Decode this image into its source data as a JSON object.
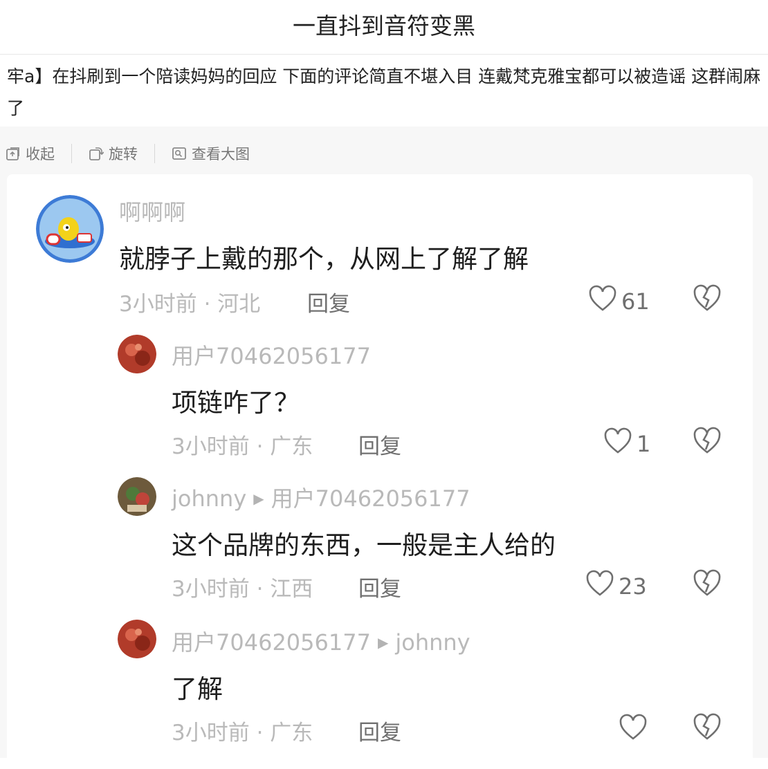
{
  "page": {
    "title": "一直抖到音符变黑",
    "post_text": "牢a】在抖刷到一个陪读妈妈的回应 下面的评论简直不堪入目 连戴梵克雅宝都可以被造谣 这群闹麻了"
  },
  "toolbar": {
    "collapse_label": "收起",
    "rotate_label": "旋转",
    "view_large_label": "查看大图"
  },
  "comments": [
    {
      "user": "啊啊啊",
      "text": "就脖子上戴的那个，从网上了解了解",
      "meta": "3小时前 · 河北",
      "reply_label": "回复",
      "likes": "61"
    },
    {
      "user": "用户70462056177",
      "text": "项链咋了？",
      "meta": "3小时前 · 广东",
      "reply_label": "回复",
      "likes": "1"
    },
    {
      "user": "johnny",
      "reply_to": "用户70462056177",
      "text": "这个品牌的东西，一般是主人给的",
      "meta": "3小时前 · 江西",
      "reply_label": "回复",
      "likes": "23"
    },
    {
      "user": "用户70462056177",
      "reply_to": "johnny",
      "text": "了解",
      "meta": "3小时前 · 广东",
      "reply_label": "回复",
      "likes": ""
    }
  ],
  "icons": {
    "collapse": "collapse-icon",
    "rotate": "rotate-icon",
    "view_large": "view-large-icon",
    "like": "heart-icon",
    "dislike": "broken-heart-icon",
    "reply_arrow": "triangle-right-icon"
  },
  "colors": {
    "muted_text": "#b9b9b9",
    "body_text": "#1e1e1e",
    "page_bg": "#f7f7f7"
  }
}
